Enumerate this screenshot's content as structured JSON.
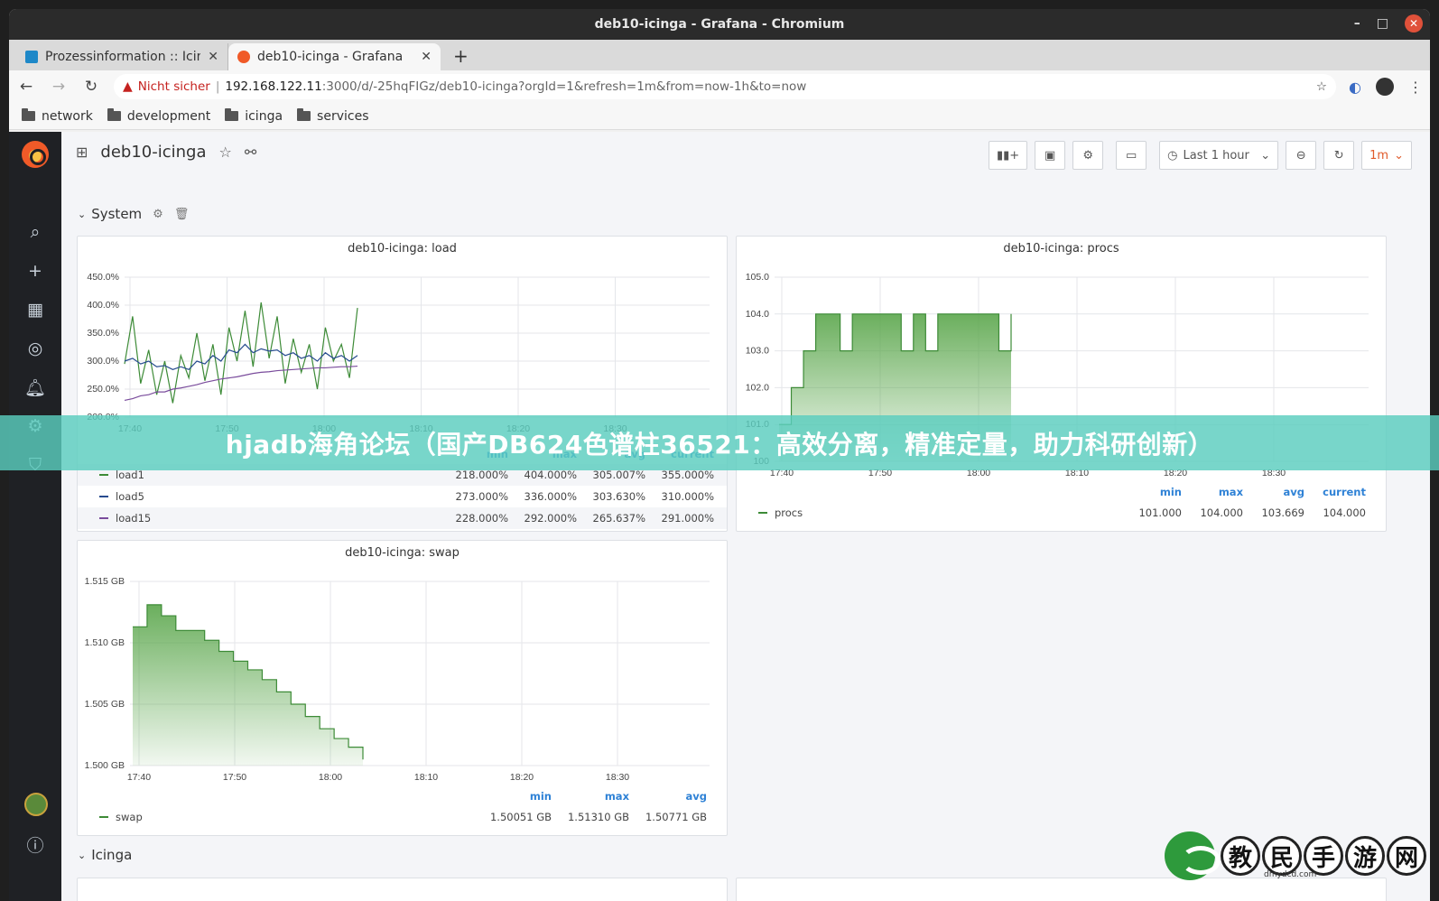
{
  "window": {
    "title": "deb10-icinga - Grafana - Chromium",
    "controls": [
      "–",
      "□",
      "✕"
    ]
  },
  "tabs": [
    {
      "label": "Prozessinformation :: Icin",
      "fav_color": "#1e88c8",
      "active": false
    },
    {
      "label": "deb10-icinga - Grafana",
      "fav_color": "#f05a28",
      "active": true
    }
  ],
  "nav": {
    "security_label": "Nicht sicher",
    "url_host": "192.168.122.11",
    "url_rest": ":3000/d/-25hqFIGz/deb10-icinga?orgId=1&refresh=1m&from=now-1h&to=now"
  },
  "bookmarks": [
    "network",
    "development",
    "icinga",
    "services"
  ],
  "dashboard": {
    "title": "deb10-icinga",
    "time_range": "Last 1 hour",
    "refresh": "1m"
  },
  "rows": {
    "system": "System",
    "icinga": "Icinga"
  },
  "panels": {
    "load": {
      "title": "deb10-icinga: load",
      "y_ticks": [
        "450.0%",
        "400.0%",
        "350.0%",
        "300.0%",
        "250.0%",
        "200.0%"
      ],
      "x_ticks": [
        "17:40",
        "17:50",
        "18:00",
        "18:10",
        "18:20",
        "18:30"
      ],
      "legend_cols": [
        "min",
        "max",
        "avg",
        "current"
      ],
      "legend": [
        {
          "name": "load1",
          "color": "#3d8b37",
          "values": [
            "218.000%",
            "404.000%",
            "305.007%",
            "355.000%"
          ]
        },
        {
          "name": "load5",
          "color": "#274b8f",
          "values": [
            "273.000%",
            "336.000%",
            "303.630%",
            "310.000%"
          ]
        },
        {
          "name": "load15",
          "color": "#7a4c9c",
          "values": [
            "228.000%",
            "292.000%",
            "265.637%",
            "291.000%"
          ]
        }
      ]
    },
    "procs": {
      "title": "deb10-icinga: procs",
      "y_ticks": [
        "105.0",
        "104.0",
        "103.0",
        "102.0",
        "101.0",
        "100"
      ],
      "x_ticks": [
        "17:40",
        "17:50",
        "18:00",
        "18:10",
        "18:20",
        "18:30"
      ],
      "legend_cols": [
        "min",
        "max",
        "avg",
        "current"
      ],
      "legend": [
        {
          "name": "procs",
          "color": "#3d8b37",
          "values": [
            "101.000",
            "104.000",
            "103.669",
            "104.000"
          ]
        }
      ]
    },
    "swap": {
      "title": "deb10-icinga: swap",
      "y_ticks": [
        "1.515 GB",
        "1.510 GB",
        "1.505 GB",
        "1.500 GB"
      ],
      "x_ticks": [
        "17:40",
        "17:50",
        "18:00",
        "18:10",
        "18:20",
        "18:30"
      ],
      "legend_cols": [
        "min",
        "max",
        "avg"
      ],
      "legend": [
        {
          "name": "swap",
          "color": "#3d8b37",
          "values": [
            "1.50051 GB",
            "1.51310 GB",
            "1.50771 GB"
          ]
        }
      ]
    }
  },
  "chart_data": [
    {
      "type": "line",
      "title": "deb10-icinga: load",
      "ylim": [
        200,
        450
      ],
      "x_range": [
        "17:37",
        "18:40"
      ],
      "series": [
        {
          "name": "load1",
          "values": [
            295,
            380,
            260,
            320,
            240,
            300,
            225,
            310,
            270,
            350,
            265,
            330,
            240,
            360,
            300,
            390,
            290,
            405,
            305,
            380,
            260,
            340,
            280,
            330,
            250,
            360,
            300,
            330,
            270,
            395
          ]
        },
        {
          "name": "load5",
          "values": [
            300,
            305,
            295,
            300,
            290,
            292,
            285,
            290,
            285,
            300,
            295,
            310,
            300,
            320,
            315,
            330,
            315,
            322,
            318,
            320,
            310,
            315,
            305,
            310,
            300,
            315,
            305,
            310,
            300,
            310
          ]
        },
        {
          "name": "load15",
          "values": [
            230,
            233,
            238,
            240,
            245,
            245,
            250,
            252,
            255,
            258,
            262,
            265,
            268,
            270,
            272,
            275,
            278,
            280,
            281,
            283,
            284,
            285,
            286,
            287,
            288,
            288,
            289,
            290,
            290,
            291
          ]
        }
      ]
    },
    {
      "type": "area",
      "title": "deb10-icinga: procs",
      "ylim": [
        100,
        105
      ],
      "x_range": [
        "17:37",
        "18:40"
      ],
      "series": [
        {
          "name": "procs",
          "values": [
            101,
            102,
            103,
            104,
            104,
            103,
            104,
            104,
            104,
            104,
            103,
            104,
            103,
            104,
            104,
            104,
            104,
            104,
            103,
            104
          ]
        }
      ]
    },
    {
      "type": "area",
      "title": "deb10-icinga: swap",
      "ylim": [
        1.5,
        1.515
      ],
      "x_range": [
        "17:37",
        "18:40"
      ],
      "series": [
        {
          "name": "swap",
          "values": [
            1.5113,
            1.5131,
            1.5122,
            1.511,
            1.511,
            1.5102,
            1.5093,
            1.5085,
            1.5078,
            1.507,
            1.506,
            1.505,
            1.504,
            1.503,
            1.5022,
            1.5015,
            1.5005
          ]
        }
      ]
    }
  ],
  "banner": "hjadb海角论坛（国产DB624色谱柱36521：高效分离，精准定量，助力科研创新）",
  "watermark": {
    "chars": [
      "教",
      "民",
      "手",
      "游",
      "网"
    ],
    "sub": "dmydcd.com"
  }
}
